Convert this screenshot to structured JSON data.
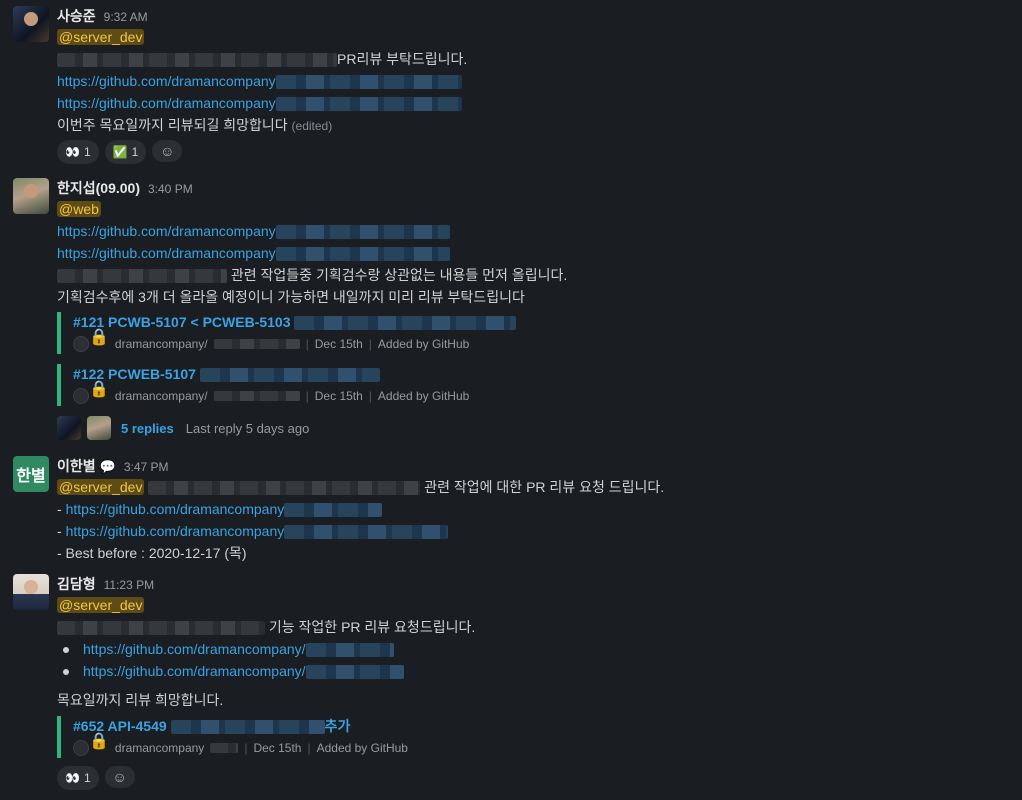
{
  "messages": [
    {
      "sender": "사승준",
      "time": "9:32 AM",
      "mention": "@server_dev",
      "line1_suffix": "PR리뷰 부탁드립니다.",
      "link_prefix": "https://github.com/dramancompany",
      "closing": "이번주 목요일까지 리뷰되길 희망합니다",
      "edited": "(edited)",
      "reactions": [
        {
          "emoji": "👀",
          "count": "1"
        },
        {
          "emoji": "✅",
          "count": "1"
        }
      ]
    },
    {
      "sender": "한지섭(09.00)",
      "time": "3:40 PM",
      "mention": "@web",
      "link_prefix": "https://github.com/dramancompany",
      "line3_suffix": "관련 작업들중 기획검수랑 상관없는 내용들 먼저 올립니다.",
      "line4": "기획검수후에 3개 더 올라올 예정이니 가능하면 내일까지 미리 리뷰 부탁드립니다",
      "attachments": [
        {
          "title": "#121 PCWB-5107 < PCWEB-5103",
          "repo": "dramancompany/",
          "date": "Dec 15th",
          "added_by": "Added by GitHub"
        },
        {
          "title": "#122 PCWEB-5107",
          "repo": "dramancompany/",
          "date": "Dec 15th",
          "added_by": "Added by GitHub"
        }
      ],
      "thread": {
        "replies": "5 replies",
        "last_reply": "Last reply 5 days ago"
      }
    },
    {
      "sender": "이한별",
      "avatar_text": "한별",
      "status_icon": "💬",
      "time": "3:47 PM",
      "mention": "@server_dev",
      "line1_suffix": "관련 작업에 대한 PR 리뷰 요청 드립니다.",
      "dash": "- ",
      "link_prefix": "https://github.com/dramancompany",
      "best_before": "- Best before : 2020-12-17 (목)"
    },
    {
      "sender": "김담형",
      "time": "11:23 PM",
      "mention": "@server_dev",
      "line1_suffix": "기능 작업한 PR 리뷰 요청드립니다.",
      "link_prefix": "https://github.com/dramancompany/",
      "closing": "목요일까지 리뷰 희망합니다.",
      "attachment": {
        "title": "#652 API-4549",
        "title_suffix": "추가",
        "repo": "dramancompany",
        "date": "Dec 15th",
        "added_by": "Added by GitHub"
      },
      "reactions": [
        {
          "emoji": "👀",
          "count": "1"
        }
      ]
    }
  ],
  "icons": {
    "add_reaction": "add-reaction-icon",
    "lock": "🔒"
  }
}
